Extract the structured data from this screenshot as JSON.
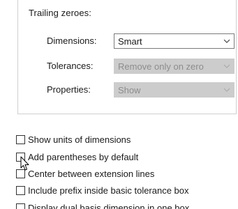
{
  "trailing_zeroes": {
    "title": "Trailing zeroes:",
    "rows": [
      {
        "label": "Dimensions:",
        "value": "Smart",
        "enabled": true
      },
      {
        "label": "Tolerances:",
        "value": "Remove only on zero",
        "enabled": false
      },
      {
        "label": "Properties:",
        "value": "Show",
        "enabled": false
      }
    ]
  },
  "options": [
    {
      "label": "Show units of dimensions",
      "checked": false
    },
    {
      "label": "Add parentheses by default",
      "checked": false
    },
    {
      "label": "Center between extension lines",
      "checked": false
    },
    {
      "label": "Include prefix inside basic tolerance box",
      "checked": false
    },
    {
      "label": "Display dual basis dimension in one box",
      "checked": false
    }
  ],
  "icons": {
    "dropdown": "chevron-down-icon",
    "pointer": "mouse-pointer-icon"
  },
  "colors": {
    "disabled_fill": "#cccccc",
    "disabled_text": "#8d8d8d",
    "border": "#7a7a7a"
  }
}
